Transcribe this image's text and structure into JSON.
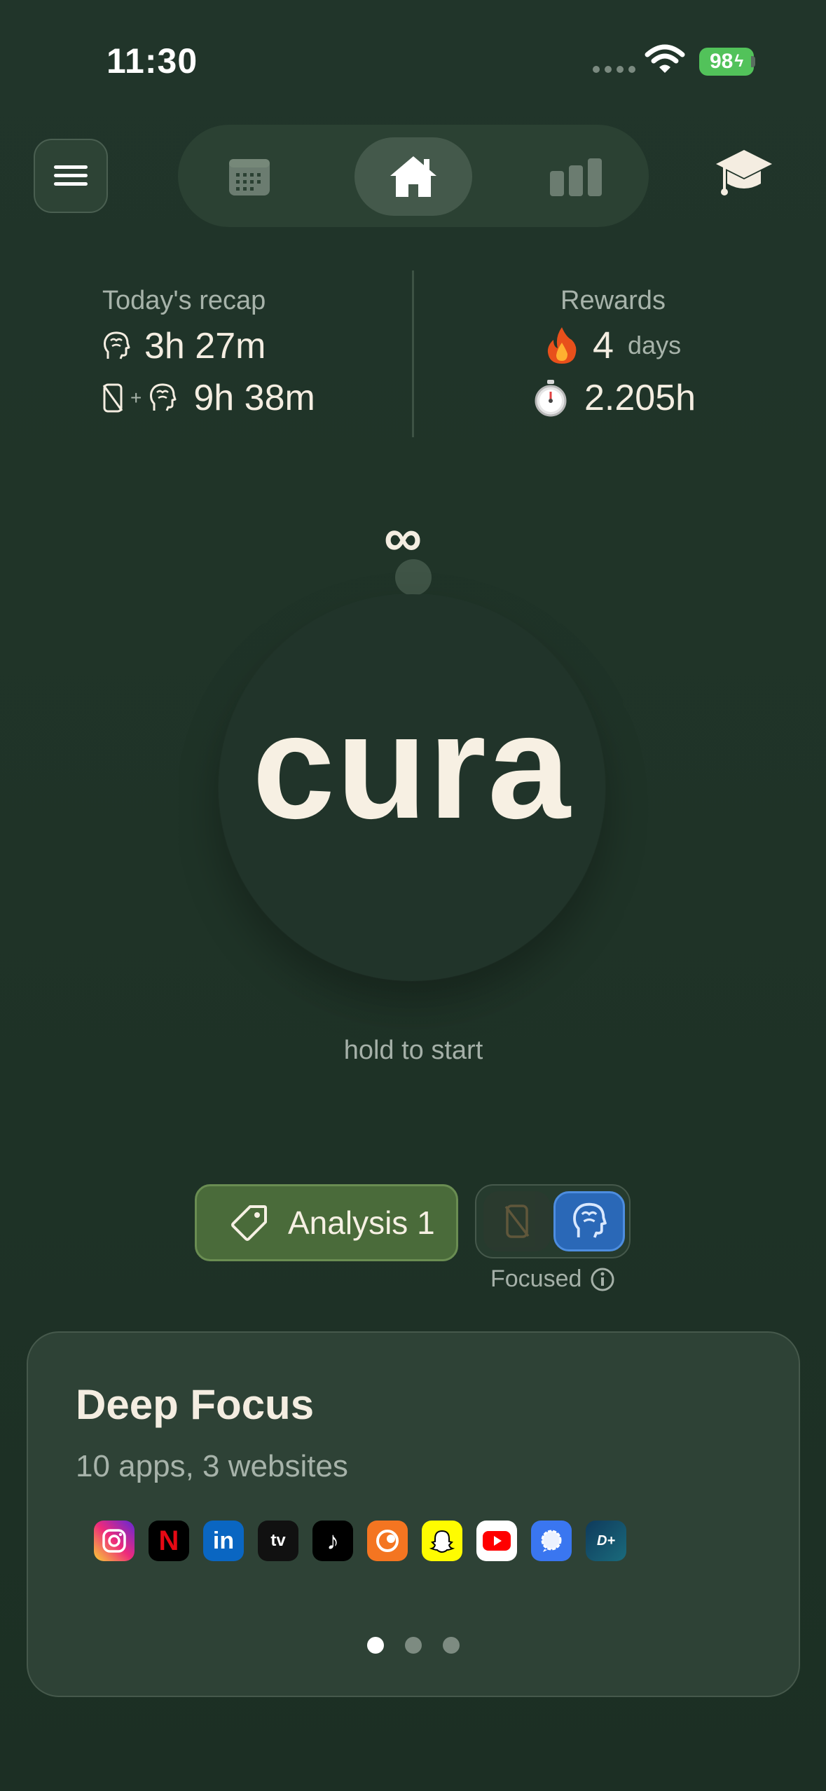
{
  "status_bar": {
    "time": "11:30",
    "battery": "98"
  },
  "nav": {
    "tabs": [
      {
        "name": "calendar-icon"
      },
      {
        "name": "home-icon",
        "selected": true
      },
      {
        "name": "bar-chart-icon"
      }
    ]
  },
  "recap": {
    "label": "Today's recap",
    "focus_time": "3h 27m",
    "combined_time": "9h 38m",
    "plus": "+"
  },
  "rewards": {
    "label": "Rewards",
    "streak_value": "4",
    "streak_unit": "days",
    "total_hours": "2.205h"
  },
  "session": {
    "duration_symbol": "∞",
    "brand": "cura",
    "hint": "hold to start"
  },
  "tag": {
    "label": "Analysis 1"
  },
  "mode": {
    "label": "Focused",
    "selected": "brain"
  },
  "card": {
    "title": "Deep Focus",
    "subtitle": "10 apps, 3 websites",
    "apps": [
      {
        "name": "instagram",
        "color": "#d62976"
      },
      {
        "name": "netflix",
        "color": "#000000",
        "glyph": "N"
      },
      {
        "name": "linkedin",
        "color": "#0a66c2",
        "glyph": "in"
      },
      {
        "name": "apple-tv",
        "color": "#111111",
        "glyph": "tv"
      },
      {
        "name": "tiktok",
        "color": "#000000",
        "glyph": "♪"
      },
      {
        "name": "crunchyroll",
        "color": "#f47521"
      },
      {
        "name": "snapchat",
        "color": "#fffc00"
      },
      {
        "name": "youtube",
        "color": "#ffffff"
      },
      {
        "name": "signal",
        "color": "#3a76f0"
      },
      {
        "name": "disney-plus",
        "color": "#0f3a5c",
        "glyph": "D+"
      }
    ],
    "pages": 3,
    "active_page": 1
  },
  "colors": {
    "background": "#21352a",
    "text": "#f4ede1",
    "muted": "#a7b3aa",
    "tag_green": "#4a6b3a",
    "mode_blue": "#2a68b7",
    "battery": "#52c25a"
  }
}
